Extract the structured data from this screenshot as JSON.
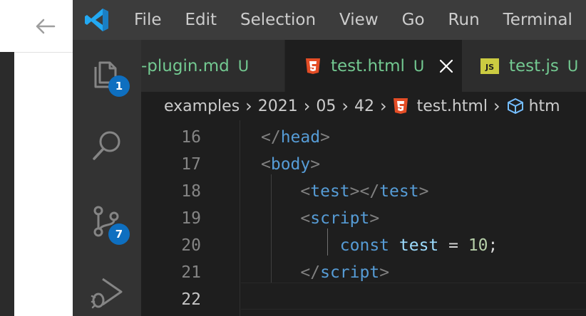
{
  "menu": [
    "File",
    "Edit",
    "Selection",
    "View",
    "Go",
    "Run",
    "Terminal"
  ],
  "activity": {
    "explorer_badge": "1",
    "scm_badge": "7"
  },
  "tabs": [
    {
      "name": "-plugin.md",
      "status": "U",
      "active": false
    },
    {
      "name": "test.html",
      "status": "U",
      "active": true
    },
    {
      "name": "test.js",
      "status": "U",
      "active": false
    }
  ],
  "breadcrumb": [
    "examples",
    "2021",
    "05",
    "42",
    "test.html",
    "htm"
  ],
  "editor": {
    "lines": [
      {
        "num": "16",
        "segments": [
          [
            "punc",
            "</"
          ],
          [
            "tag",
            "head"
          ],
          [
            "punc",
            ">"
          ]
        ]
      },
      {
        "num": "17",
        "segments": [
          [
            "punc",
            "<"
          ],
          [
            "tag",
            "body"
          ],
          [
            "punc",
            ">"
          ]
        ]
      },
      {
        "num": "18",
        "segments": [
          [
            "plain",
            "    "
          ],
          [
            "punc",
            "<"
          ],
          [
            "tag",
            "test"
          ],
          [
            "punc",
            "></"
          ],
          [
            "tag",
            "test"
          ],
          [
            "punc",
            ">"
          ]
        ]
      },
      {
        "num": "19",
        "segments": [
          [
            "plain",
            "    "
          ],
          [
            "punc",
            "<"
          ],
          [
            "tag",
            "script"
          ],
          [
            "punc",
            ">"
          ]
        ]
      },
      {
        "num": "20",
        "segments": [
          [
            "plain",
            "        "
          ],
          [
            "kw",
            "const"
          ],
          [
            "plain",
            " "
          ],
          [
            "var",
            "test"
          ],
          [
            "plain",
            " = "
          ],
          [
            "num",
            "10"
          ],
          [
            "plain",
            ";"
          ]
        ]
      },
      {
        "num": "21",
        "segments": [
          [
            "plain",
            "    "
          ],
          [
            "punc",
            "</"
          ],
          [
            "tag",
            "script"
          ],
          [
            "punc",
            ">"
          ]
        ]
      },
      {
        "num": "22",
        "segments": []
      }
    ],
    "current_line": "22"
  },
  "colors": {
    "titlebar": "#3c3c3c",
    "activity_bar": "#333333",
    "editor_bg": "#1e1e1e",
    "tab_inactive": "#2d2d2d",
    "untracked_green": "#73c991",
    "badge_blue": "#0e6fc0",
    "html_icon": "#e44d26",
    "js_icon": "#cbcb41",
    "vscode_blue": "#23a9f2"
  }
}
